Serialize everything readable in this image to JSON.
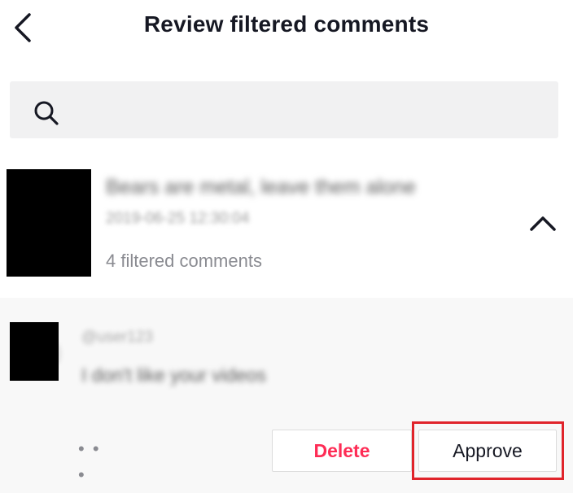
{
  "header": {
    "title": "Review filtered comments",
    "back_icon": "chevron-left-icon"
  },
  "search": {
    "icon": "search-icon",
    "value": "",
    "placeholder": ""
  },
  "video_group": {
    "caption": "Bears are metal, leave them alone",
    "date": "2019-06-25 12:30:04",
    "filtered_count_label": "4 filtered comments",
    "collapse_icon": "chevron-up-icon"
  },
  "comment": {
    "username": "@user123",
    "text": "I don't like your videos",
    "more_label": "• • •",
    "actions": {
      "delete_label": "Delete",
      "approve_label": "Approve"
    }
  },
  "colors": {
    "accent_red": "#fe2c55",
    "highlight": "#e0242b",
    "panel_bg": "#f8f8f8",
    "search_bg": "#f1f1f2"
  }
}
